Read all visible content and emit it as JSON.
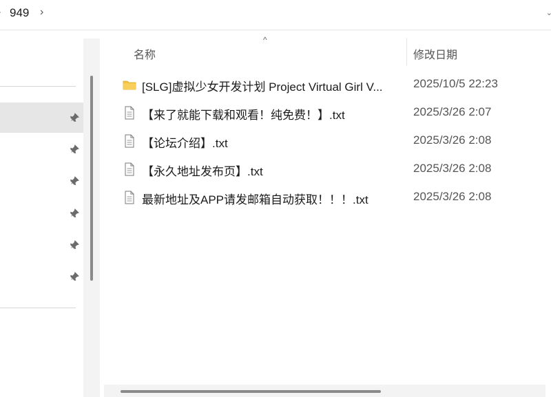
{
  "breadcrumb": {
    "segment": "949",
    "separator": "›"
  },
  "columns": {
    "sort_indicator": "^",
    "name": "名称",
    "date_modified": "修改日期"
  },
  "files": [
    {
      "type": "folder",
      "icon": "folder-icon",
      "name": "[SLG]虚拟少女开发计划  Project Virtual Girl V...",
      "date": "2025/10/5 22:23"
    },
    {
      "type": "file",
      "icon": "text-file-icon",
      "name": "【来了就能下载和观看！纯免费！】.txt",
      "date": "2025/3/26 2:07"
    },
    {
      "type": "file",
      "icon": "text-file-icon",
      "name": "【论坛介绍】.txt",
      "date": "2025/3/26 2:08"
    },
    {
      "type": "file",
      "icon": "text-file-icon",
      "name": "【永久地址发布页】.txt",
      "date": "2025/3/26 2:08"
    },
    {
      "type": "file",
      "icon": "text-file-icon",
      "name": "最新地址及APP请发邮箱自动获取！！！.txt",
      "date": "2025/3/26 2:08"
    }
  ],
  "navigation": {
    "pinned_items": 6,
    "selected_item": 1
  },
  "colors": {
    "folder": "#f4c542",
    "selection": "#e6e6e6",
    "scrollbar_thumb": "#8a8a8a"
  }
}
